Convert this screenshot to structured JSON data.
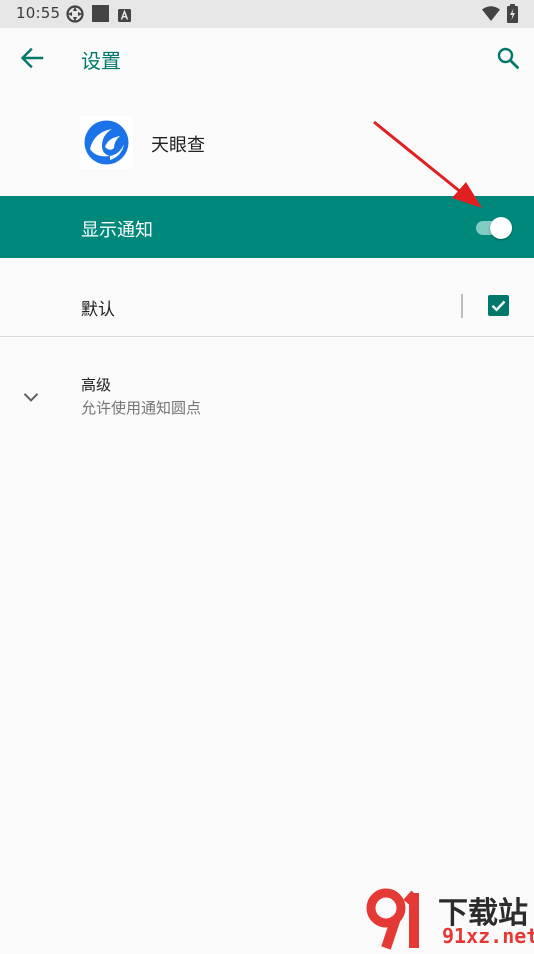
{
  "status_bar": {
    "time": "10:55",
    "icons": [
      "settings-sync-icon",
      "square-notification-icon",
      "a-notification-icon",
      "wifi-icon",
      "battery-charging-icon"
    ]
  },
  "toolbar": {
    "title": "设置",
    "back_icon": "arrow-back-icon",
    "search_icon": "search-icon"
  },
  "app": {
    "name": "天眼查",
    "icon": "tianyancha-logo-icon"
  },
  "notification_toggle": {
    "label": "显示通知",
    "enabled": true
  },
  "default_channel": {
    "label": "默认",
    "checked": true
  },
  "advanced": {
    "title": "高级",
    "summary": "允许使用通知圆点",
    "icon": "chevron-down-icon"
  },
  "watermark": {
    "title": "下载站",
    "domain": "91xz.net"
  },
  "colors": {
    "accent": "#00897b",
    "accent_text": "#00796b",
    "switch_track": "#80cbc4",
    "annotation": "#e02020"
  }
}
